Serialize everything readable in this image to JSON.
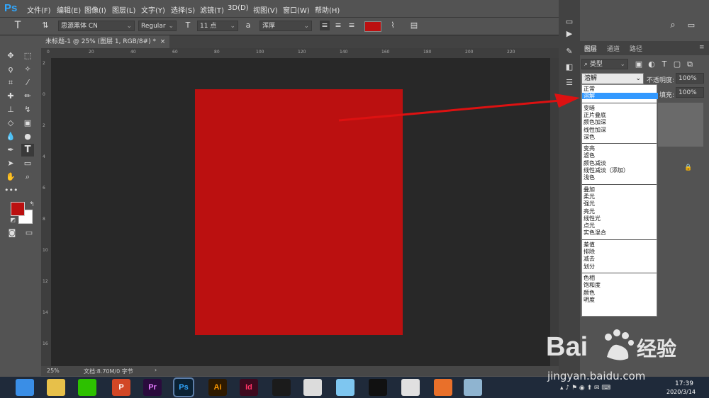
{
  "app": {
    "logo": "Ps"
  },
  "menu": [
    "文件(F)",
    "编辑(E)",
    "图像(I)",
    "图层(L)",
    "文字(Y)",
    "选择(S)",
    "滤镜(T)",
    "3D(D)",
    "视图(V)",
    "窗口(W)",
    "帮助(H)"
  ],
  "options": {
    "font_family": "思源黑体 CN",
    "font_style": "Regular",
    "font_size": "11 点",
    "aa_icon": "a",
    "antialias": "浑厚",
    "text_color": "#bb1010"
  },
  "document": {
    "tab_title": "未标题-1 @ 25% (图层 1, RGB/8#) *",
    "tab_close": "×",
    "zoom": "25%",
    "doc_info": "文档:8.70M/0 字节",
    "status_arrow": "›",
    "canvas_color": "#bb1010",
    "ruler_top": [
      "0",
      "20",
      "40",
      "60",
      "80",
      "100",
      "120",
      "140",
      "160",
      "180",
      "200",
      "220"
    ],
    "ruler_left": [
      "2",
      "0",
      "2",
      "4",
      "6",
      "8",
      "10",
      "12",
      "14",
      "16"
    ]
  },
  "panel": {
    "tabs": [
      "图层",
      "通道",
      "路径"
    ],
    "filter_label": "类型",
    "blend_mode": "溶解",
    "opacity_label": "不透明度:",
    "opacity_value": "100%",
    "fill_label": "填充:",
    "fill_value": "100%",
    "blend_groups": [
      [
        {
          "label": "正常",
          "selected": false
        },
        {
          "label": "溶解",
          "selected": true
        }
      ],
      [
        {
          "label": "变暗"
        },
        {
          "label": "正片叠底"
        },
        {
          "label": "颜色加深"
        },
        {
          "label": "线性加深"
        },
        {
          "label": "深色"
        }
      ],
      [
        {
          "label": "变亮"
        },
        {
          "label": "滤色"
        },
        {
          "label": "颜色减淡"
        },
        {
          "label": "线性减淡（添加）"
        },
        {
          "label": "浅色"
        }
      ],
      [
        {
          "label": "叠加"
        },
        {
          "label": "柔光"
        },
        {
          "label": "强光"
        },
        {
          "label": "亮光"
        },
        {
          "label": "线性光"
        },
        {
          "label": "点光"
        },
        {
          "label": "实色混合"
        }
      ],
      [
        {
          "label": "差值"
        },
        {
          "label": "排除"
        },
        {
          "label": "减去"
        },
        {
          "label": "划分"
        }
      ],
      [
        {
          "label": "色相"
        },
        {
          "label": "饱和度"
        },
        {
          "label": "颜色"
        },
        {
          "label": "明度"
        }
      ]
    ]
  },
  "colors": {
    "foreground": "#bb1010",
    "background": "#ffffff",
    "arrow": "#dd1111"
  },
  "taskbar": {
    "apps": [
      {
        "name": "browser-icon",
        "text": "",
        "color": "#3a8ee6"
      },
      {
        "name": "folder-icon",
        "text": "",
        "color": "#e7c04a"
      },
      {
        "name": "wechat-icon",
        "text": "",
        "color": "#2dc100"
      },
      {
        "name": "powerpoint-icon",
        "text": "P",
        "color": "#d24726"
      },
      {
        "name": "premiere-icon",
        "text": "Pr",
        "color": "#2a0b3d"
      },
      {
        "name": "photoshop-icon",
        "text": "Ps",
        "color": "#0b2234"
      },
      {
        "name": "illustrator-icon",
        "text": "Ai",
        "color": "#2e1a00"
      },
      {
        "name": "indesign-icon",
        "text": "Id",
        "color": "#3d0a1e"
      },
      {
        "name": "video-icon",
        "text": "",
        "color": "#1b1b1b"
      },
      {
        "name": "app-icon",
        "text": "",
        "color": "#dcdcdc"
      },
      {
        "name": "cloud-icon",
        "text": "",
        "color": "#7ec6f0"
      },
      {
        "name": "qq-icon",
        "text": "",
        "color": "#111111"
      },
      {
        "name": "chrome-icon",
        "text": "",
        "color": "#e0e0e0"
      },
      {
        "name": "fox-icon",
        "text": "",
        "color": "#e9702a"
      },
      {
        "name": "misc-icon",
        "text": "",
        "color": "#8fb4d0"
      }
    ],
    "time": "17:39",
    "date": "2020/3/14"
  },
  "watermark": {
    "text1": "Bai",
    "text2": "经验",
    "sub": "jingyan.baidu.com"
  }
}
